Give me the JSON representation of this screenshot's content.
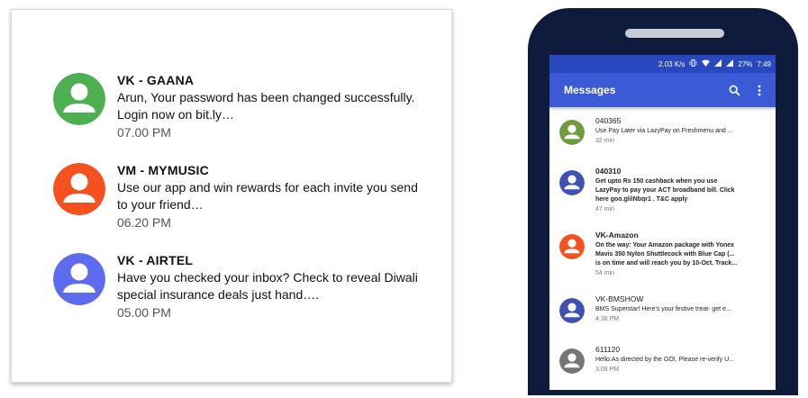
{
  "left_panel": {
    "messages": [
      {
        "sender": "VK - GAANA",
        "line1": "Arun, Your password has been changed successfully.",
        "line2": "Login now on bit.ly…",
        "time": "07.00 PM",
        "avatar_color": "#4caf50"
      },
      {
        "sender": "VM - MYMUSIC",
        "line1": "Use our app and win rewards for each invite you send",
        "line2": "to your friend…",
        "time": "06.20 PM",
        "avatar_color": "#f4511e"
      },
      {
        "sender": "VK - AIRTEL",
        "line1": "Have you checked your inbox? Check to reveal Diwali",
        "line2": "special insurance deals just hand….",
        "time": "05.00 PM",
        "avatar_color": "#5c6bf0"
      }
    ]
  },
  "phone": {
    "status_bar": {
      "speed": "2.03 K/s",
      "battery": "27%",
      "clock": "7:49"
    },
    "app_bar": {
      "title": "Messages",
      "search_icon": "search-icon",
      "more_icon": "more-vert-icon"
    },
    "messages": [
      {
        "sender": "040365",
        "lines": [
          "Use Pay Later via LazyPay on Freshmenu and ..."
        ],
        "time": "32 min",
        "unread": false,
        "avatar_color": "#6d9c3c"
      },
      {
        "sender": "040310",
        "lines": [
          "Get upto Rs 150 cashback when you use",
          "LazyPay to pay your ACT broadband bill. Click",
          "here goo.gl/iNbqr1 . T&C apply"
        ],
        "time": "47 min",
        "unread": true,
        "avatar_color": "#3f51b5"
      },
      {
        "sender": "VK-Amazon",
        "lines": [
          "On the way: Your Amazon package with Yonex",
          "Mavis 350 Nylon Shuttlecock with Blue Cap (...",
          "is on time and will reach you by 10-Oct. Track..."
        ],
        "time": "54 min",
        "unread": true,
        "avatar_color": "#f4511e"
      },
      {
        "sender": "VK-BMSHOW",
        "lines": [
          "BMS Superstar! Here's your festive treat- get e..."
        ],
        "time": "4:38 PM",
        "unread": false,
        "avatar_color": "#3f51b5"
      },
      {
        "sender": "611120",
        "lines": [
          "Hello.As directed by the GOI, Please re-verify U..."
        ],
        "time": "3:08 PM",
        "unread": false,
        "avatar_color": "#757575"
      }
    ]
  }
}
